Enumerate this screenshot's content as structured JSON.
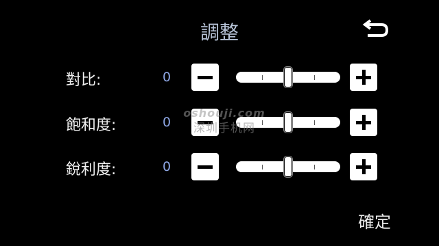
{
  "title": "調整",
  "back_icon": "back-arrow-icon",
  "rows": [
    {
      "label": "對比:",
      "value": "0",
      "level": 0.5
    },
    {
      "label": "飽和度:",
      "value": "0",
      "level": 0.5
    },
    {
      "label": "銳利度:",
      "value": "0",
      "level": 0.5
    }
  ],
  "watermark": {
    "line1": "oshouji.com",
    "line2": "深圳手机网"
  },
  "confirm_label": "確定"
}
